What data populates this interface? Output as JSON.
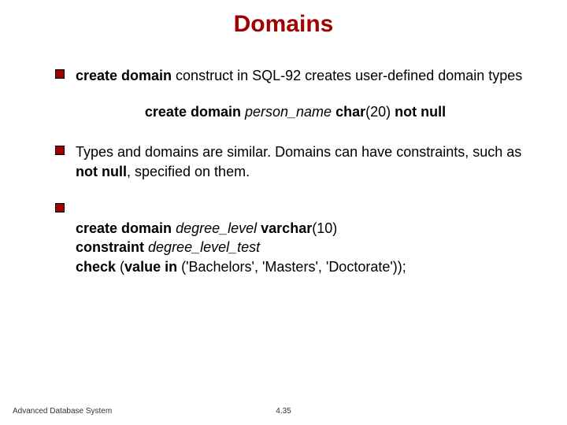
{
  "title": "Domains",
  "bullets": [
    {
      "parts": [
        {
          "text": "create domain",
          "style": "b"
        },
        {
          "text": " construct in SQL-92 creates user-defined domain types",
          "style": ""
        }
      ]
    },
    {
      "parts": [
        {
          "text": "Types and domains are similar.  Domains can have constraints, such as ",
          "style": ""
        },
        {
          "text": "not null",
          "style": "b"
        },
        {
          "text": ", specified on them.",
          "style": ""
        }
      ]
    },
    {
      "parts": [
        {
          "text": "create domain",
          "style": "b"
        },
        {
          "text": " ",
          "style": ""
        },
        {
          "text": "degree_level",
          "style": "i"
        },
        {
          "text": " ",
          "style": ""
        },
        {
          "text": "varchar",
          "style": "b"
        },
        {
          "text": "(10)\n",
          "style": ""
        },
        {
          "text": "constraint",
          "style": "b"
        },
        {
          "text": " ",
          "style": ""
        },
        {
          "text": "degree_level_test",
          "style": "i"
        },
        {
          "text": "\n",
          "style": ""
        },
        {
          "text": "check",
          "style": "b"
        },
        {
          "text": " (",
          "style": ""
        },
        {
          "text": "value in",
          "style": "b"
        },
        {
          "text": " ('Bachelors', 'Masters', 'Doctorate'));",
          "style": ""
        }
      ]
    }
  ],
  "centered_example": [
    {
      "text": "create domain",
      "style": "b"
    },
    {
      "text": " ",
      "style": ""
    },
    {
      "text": "person_name",
      "style": "i"
    },
    {
      "text": " ",
      "style": ""
    },
    {
      "text": "char",
      "style": "b"
    },
    {
      "text": "(20) ",
      "style": ""
    },
    {
      "text": "not null",
      "style": "b"
    }
  ],
  "footer": {
    "left": "Advanced Database System",
    "center": "4.35"
  }
}
